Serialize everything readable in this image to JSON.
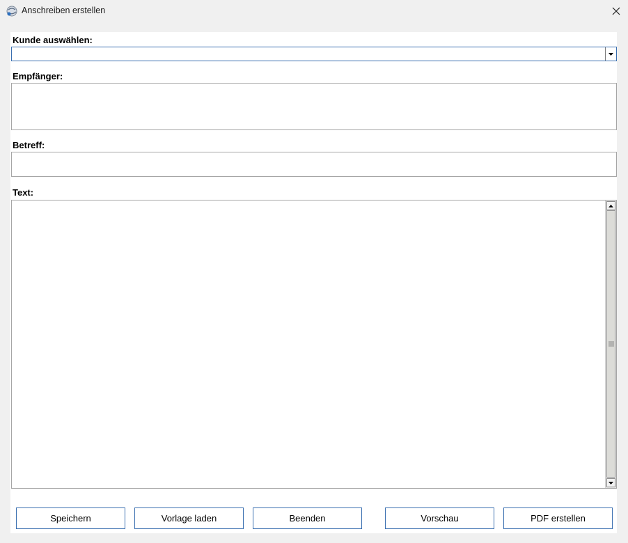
{
  "window": {
    "title": "Anschreiben erstellen",
    "app_icon": "app-globe-icon",
    "close_icon": "close-icon"
  },
  "form": {
    "customer_label": "Kunde auswählen:",
    "customer_value": "",
    "recipient_label": "Empfänger:",
    "recipient_value": "",
    "subject_label": "Betreff:",
    "subject_value": "",
    "text_label": "Text:",
    "text_value": ""
  },
  "buttons": {
    "save": "Speichern",
    "load_template": "Vorlage laden",
    "quit": "Beenden",
    "preview": "Vorschau",
    "create_pdf": "PDF erstellen"
  },
  "colors": {
    "accent_border": "#3a6fb0",
    "background": "#f0f0f0"
  }
}
